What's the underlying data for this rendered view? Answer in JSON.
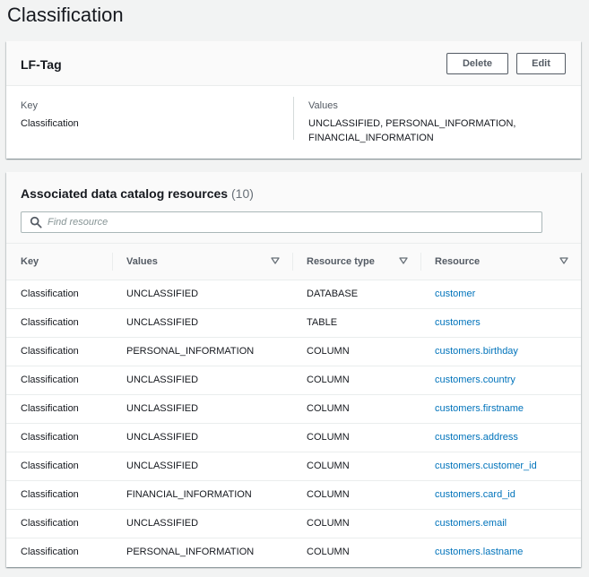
{
  "page": {
    "title": "Classification"
  },
  "lf_tag": {
    "title": "LF-Tag",
    "delete_label": "Delete",
    "edit_label": "Edit",
    "key_label": "Key",
    "key_value": "Classification",
    "values_label": "Values",
    "values_line1": "UNCLASSIFIED, PERSONAL_INFORMATION,",
    "values_line2": "FINANCIAL_INFORMATION"
  },
  "resources": {
    "title": "Associated data catalog resources",
    "count": "(10)",
    "search_placeholder": "Find resource",
    "columns": [
      "Key",
      "Values",
      "Resource type",
      "Resource"
    ],
    "rows": [
      [
        "Classification",
        "UNCLASSIFIED",
        "DATABASE",
        "customer"
      ],
      [
        "Classification",
        "UNCLASSIFIED",
        "TABLE",
        "customers"
      ],
      [
        "Classification",
        "PERSONAL_INFORMATION",
        "COLUMN",
        "customers.birthday"
      ],
      [
        "Classification",
        "UNCLASSIFIED",
        "COLUMN",
        "customers.country"
      ],
      [
        "Classification",
        "UNCLASSIFIED",
        "COLUMN",
        "customers.firstname"
      ],
      [
        "Classification",
        "UNCLASSIFIED",
        "COLUMN",
        "customers.address"
      ],
      [
        "Classification",
        "UNCLASSIFIED",
        "COLUMN",
        "customers.customer_id"
      ],
      [
        "Classification",
        "FINANCIAL_INFORMATION",
        "COLUMN",
        "customers.card_id"
      ],
      [
        "Classification",
        "UNCLASSIFIED",
        "COLUMN",
        "customers.email"
      ],
      [
        "Classification",
        "PERSONAL_INFORMATION",
        "COLUMN",
        "customers.lastname"
      ]
    ]
  },
  "colors": {
    "link": "#0073bb",
    "text": "#16191f",
    "muted": "#545b64",
    "background": "#f2f3f3"
  }
}
